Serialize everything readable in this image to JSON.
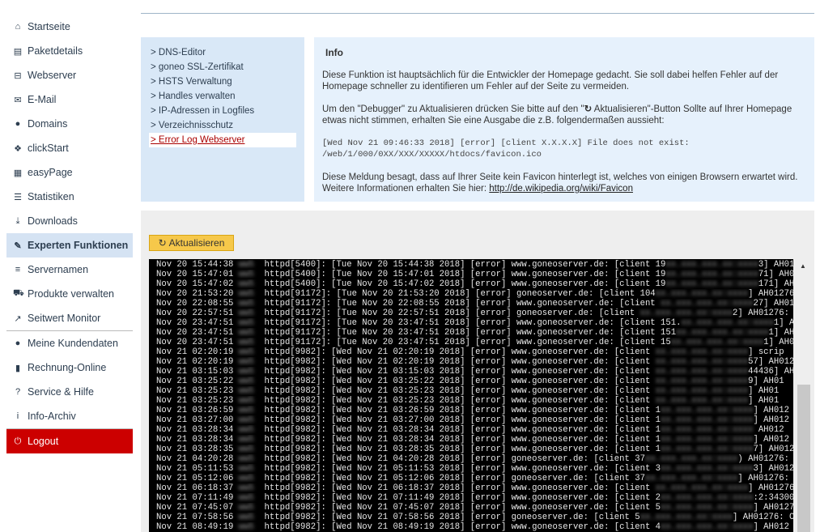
{
  "sidebar": {
    "items": [
      {
        "label": "Startseite",
        "icon": "home-icon",
        "glyph": "⌂"
      },
      {
        "label": "Paketdetails",
        "icon": "list-alt-icon",
        "glyph": "▤"
      },
      {
        "label": "Webserver",
        "icon": "hdd-icon",
        "glyph": "⊟"
      },
      {
        "label": "E-Mail",
        "icon": "envelope-icon",
        "glyph": "✉"
      },
      {
        "label": "Domains",
        "icon": "globe-icon",
        "glyph": "●"
      },
      {
        "label": "clickStart",
        "icon": "cubes-icon",
        "glyph": "❖"
      },
      {
        "label": "easyPage",
        "icon": "th-large-icon",
        "glyph": "▦"
      },
      {
        "label": "Statistiken",
        "icon": "stats-icon",
        "glyph": "☰"
      },
      {
        "label": "Downloads",
        "icon": "download-icon",
        "glyph": "⤓"
      },
      {
        "label": "Experten Funktionen",
        "icon": "wrench-icon",
        "glyph": "✎",
        "active": true
      },
      {
        "label": "Servernamen",
        "icon": "align-left-icon",
        "glyph": "≡"
      },
      {
        "label": "Produkte verwalten",
        "icon": "cart-icon",
        "glyph": "⛟"
      },
      {
        "label": "Seitwert Monitor",
        "icon": "share-icon",
        "glyph": "↗"
      },
      {
        "label": "Meine Kundendaten",
        "icon": "user-icon",
        "glyph": "●"
      },
      {
        "label": "Rechnung-Online",
        "icon": "book-icon",
        "glyph": "▮"
      },
      {
        "label": "Service & Hilfe",
        "icon": "question-icon",
        "glyph": "?"
      },
      {
        "label": "Info-Archiv",
        "icon": "info-icon",
        "glyph": "i"
      },
      {
        "label": "Logout",
        "icon": "power-icon",
        "glyph": "⏻"
      }
    ]
  },
  "links": [
    "> DNS-Editor",
    "> goneo SSL-Zertifikat",
    "> HSTS Verwaltung",
    "> Handles verwalten",
    "> IP-Adressen in Logfiles",
    "> Verzeichnisschutz",
    "> Error Log Webserver"
  ],
  "info": {
    "title": "Info",
    "p1": "Diese Funktion ist hauptsächlich für die Entwickler der Homepage gedacht. Sie soll dabei helfen Fehler auf der Homepage schneller zu identifieren um Fehler auf der Seite zu vermeiden.",
    "p2a": "Um den \"Debugger\" zu Aktualisieren drücken Sie bitte auf den \"",
    "p2b": " Aktualisieren\"-Button Sollte auf Ihrer Homepage etwas nicht stimmen, erhalten Sie eine Ausgabe die z.B. folgendermaßen aussieht:",
    "code1": "[Wed Nov 21 09:46:33 2018] [error] [client X.X.X.X] File does not exist:",
    "code2": "/web/1/000/0XX/XXX/XXXXX/htdocs/favicon.ico",
    "p3": "Diese Meldung besagt, dass auf Ihrer Seite kein Favicon hinterlegt ist, welches von einigen Browsern erwartet wird. Weitere Informationen erhalten Sie hier: ",
    "link": "http://de.wikipedia.org/wiki/Favicon"
  },
  "refresh_button": "Aktualisieren",
  "log": [
    [
      "Nov 20 15:44:38",
      "httpd[5400]: [Tue Nov 20 15:44:38 2018] [error] www.goneoserver.de: [client 19",
      "3] AH01"
    ],
    [
      "Nov 20 15:47:01",
      "httpd[5400]: [Tue Nov 20 15:47:01 2018] [error] www.goneoserver.de: [client 19",
      "71] AH012"
    ],
    [
      "Nov 20 15:47:02",
      "httpd[5400]: [Tue Nov 20 15:47:02 2018] [error] www.goneoserver.de: [client 19",
      "171] AH012"
    ],
    [
      "Nov 20 21:53:20",
      "httpd[91172]: [Tue Nov 20 21:53:20 2018] [error] goneoserver.de: [client 104",
      "] AH01276:"
    ],
    [
      "Nov 20 22:08:55",
      "httpd[91172]: [Tue Nov 20 22:08:55 2018] [error] www.goneoserver.de: [client ",
      "27] AH0127"
    ],
    [
      "Nov 20 22:57:51",
      "httpd[91172]: [Tue Nov 20 22:57:51 2018] [error] goneoserver.de: [client ",
      "2] AH01276: C"
    ],
    [
      "Nov 20 23:47:51",
      "httpd[91172]: [Tue Nov 20 23:47:51 2018] [error] www.goneoserver.de: [client 151.",
      "1] AH01"
    ],
    [
      "Nov 20 23:47:51",
      "httpd[91172]: [Tue Nov 20 23:47:51 2018] [error] www.goneoserver.de: [client 151",
      "1] AH01"
    ],
    [
      "Nov 20 23:47:51",
      "httpd[91172]: [Tue Nov 20 23:47:51 2018] [error] www.goneoserver.de: [client 15",
      "1] AH01"
    ],
    [
      "Nov 21 02:20:19",
      "httpd[9982]: [Wed Nov 21 02:20:19 2018] [error] www.goneoserver.de: [client ",
      "] scrip"
    ],
    [
      "Nov 21 02:20:19",
      "httpd[9982]: [Wed Nov 21 02:20:19 2018] [error] www.goneoserver.de: [client ",
      "57] AH012"
    ],
    [
      "Nov 21 03:15:03",
      "httpd[9982]: [Wed Nov 21 03:15:03 2018] [error] www.goneoserver.de: [client ",
      "44436] AH0127"
    ],
    [
      "Nov 21 03:25:22",
      "httpd[9982]: [Wed Nov 21 03:25:22 2018] [error] www.goneoserver.de: [client ",
      "9] AH01"
    ],
    [
      "Nov 21 03:25:23",
      "httpd[9982]: [Wed Nov 21 03:25:23 2018] [error] www.goneoserver.de: [client ",
      "] AH01"
    ],
    [
      "Nov 21 03:25:23",
      "httpd[9982]: [Wed Nov 21 03:25:23 2018] [error] www.goneoserver.de: [client ",
      "] AH01"
    ],
    [
      "Nov 21 03:26:59",
      "httpd[9982]: [Wed Nov 21 03:26:59 2018] [error] www.goneoserver.de: [client 1",
      "] AH012"
    ],
    [
      "Nov 21 03:27:00",
      "httpd[9982]: [Wed Nov 21 03:27:00 2018] [error] www.goneoserver.de: [client 1",
      "] AH012"
    ],
    [
      "Nov 21 03:28:34",
      "httpd[9982]: [Wed Nov 21 03:28:34 2018] [error] www.goneoserver.de: [client 1",
      " AH012"
    ],
    [
      "Nov 21 03:28:34",
      "httpd[9982]: [Wed Nov 21 03:28:34 2018] [error] www.goneoserver.de: [client 1",
      "] AH012"
    ],
    [
      "Nov 21 03:28:35",
      "httpd[9982]: [Wed Nov 21 03:28:35 2018] [error] www.goneoserver.de: [client 1",
      "7] AH012"
    ],
    [
      "Nov 21 04:20:28",
      "httpd[9982]: [Wed Nov 21 04:20:28 2018] [error] goneoserver.de: [client 37",
      ") AH01276: Ca"
    ],
    [
      "Nov 21 05:11:53",
      "httpd[9982]: [Wed Nov 21 05:11:53 2018] [error] www.goneoserver.de: [client 3",
      "3] AH01276"
    ],
    [
      "Nov 21 05:12:06",
      "httpd[9982]: [Wed Nov 21 05:12:06 2018] [error] goneoserver.de: [client 37",
      "] AH01276: Ca"
    ],
    [
      "Nov 21 06:18:37",
      "httpd[9982]: [Wed Nov 21 06:18:37 2018] [error] www.goneoserver.de: [client ",
      "] AH01276"
    ],
    [
      "Nov 21 07:11:49",
      "httpd[9982]: [Wed Nov 21 07:11:49 2018] [error] www.goneoserver.de: [client 2",
      ":2:34300]"
    ],
    [
      "Nov 21 07:45:07",
      "httpd[9982]: [Wed Nov 21 07:45:07 2018] [error] www.goneoserver.de: [client 5",
      "] AH0127"
    ],
    [
      "Nov 21 07:58:56",
      "httpd[9982]: [Wed Nov 21 07:58:56 2018] [error] goneoserver.de: [client 5",
      "] AH01276: Can"
    ],
    [
      "Nov 21 08:49:19",
      "httpd[9982]: [Wed Nov 21 08:49:19 2018] [error] www.goneoserver.de: [client 4",
      "] AH012"
    ]
  ],
  "colors": {
    "accent_active": "#d5e3f3",
    "logout": "#cc0000",
    "button": "#f6c84a",
    "panel": "#d9e8f7",
    "info_panel": "#e6f1fc",
    "log_bg": "#000000"
  }
}
